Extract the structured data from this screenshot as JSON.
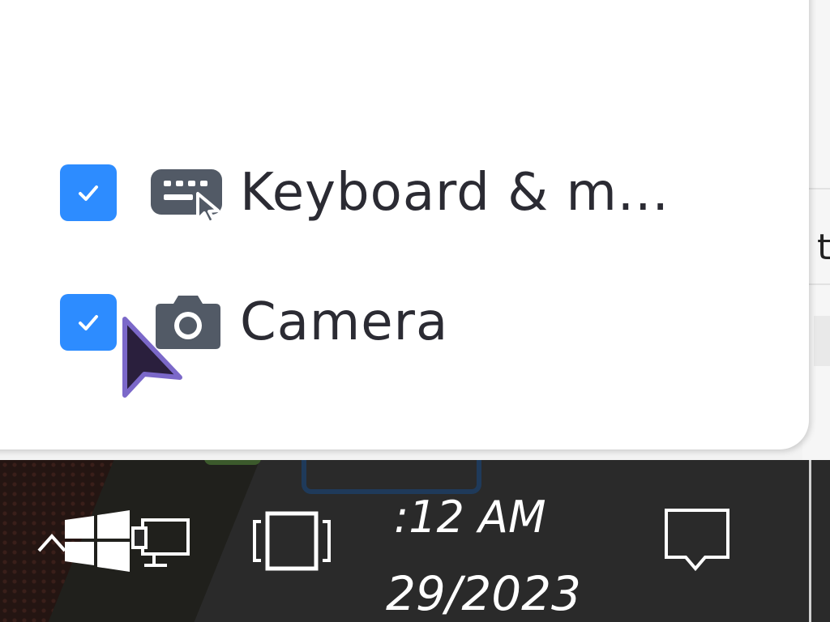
{
  "permissions_panel": {
    "options": [
      {
        "label": "Keyboard & m...",
        "checked": true,
        "icon": "keyboard-mouse-icon"
      },
      {
        "label": "Camera",
        "checked": true,
        "icon": "camera-icon"
      }
    ]
  },
  "background_window": {
    "edge_text": "t"
  },
  "taskbar": {
    "clock_time": ":12 AM",
    "clock_date": "29/2023",
    "icons": [
      "chevron-up-icon",
      "windows-start-icon",
      "network-icon",
      "task-view-icon",
      "notification-icon"
    ]
  },
  "colors": {
    "checkbox": "#2d8cff",
    "icon": "#525a66",
    "label": "#2b2b33",
    "taskbar": "#2a2a2a",
    "pointer_fill": "#2a1f3d",
    "pointer_outline": "#7b68c9"
  }
}
